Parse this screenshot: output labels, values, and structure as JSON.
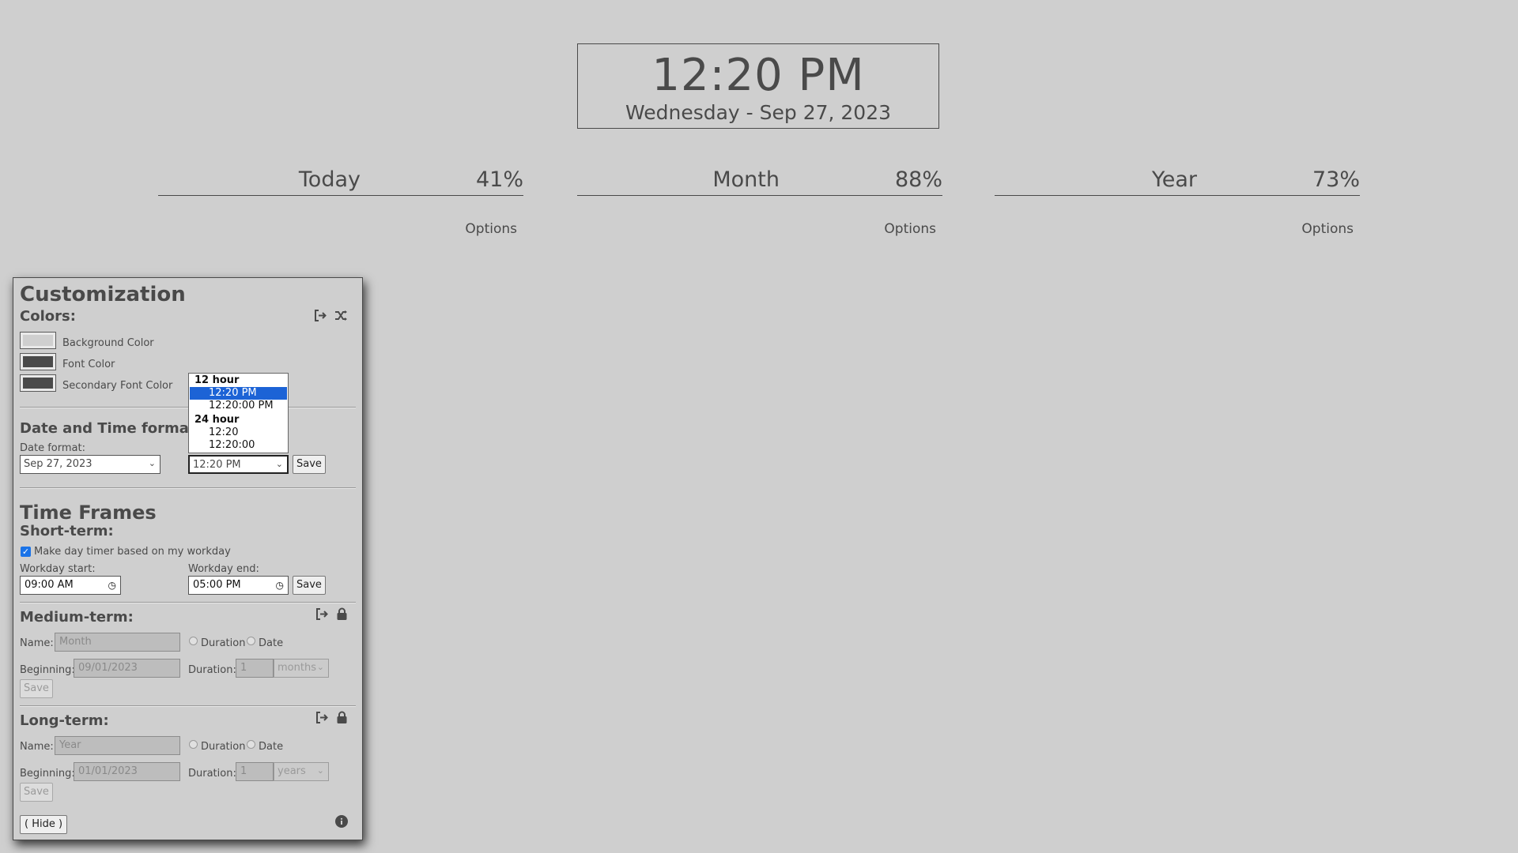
{
  "clock": {
    "time": "12:20 PM",
    "date": "Wednesday - Sep 27, 2023"
  },
  "timers": [
    {
      "name": "Today",
      "percent": "41%",
      "options_label": "Options"
    },
    {
      "name": "Month",
      "percent": "88%",
      "options_label": "Options"
    },
    {
      "name": "Year",
      "percent": "73%",
      "options_label": "Options"
    }
  ],
  "panel": {
    "title": "Customization",
    "colors": {
      "heading": "Colors:",
      "items": [
        {
          "label": "Background Color",
          "value": "#cfcfcf"
        },
        {
          "label": "Font Color",
          "value": "#4a4a4a"
        },
        {
          "label": "Secondary Font Color",
          "value": "#4a4a4a"
        }
      ]
    },
    "datetime": {
      "heading": "Date and Time forma",
      "date_format_label": "Date format:",
      "date_format_value": "Sep 27, 2023",
      "time_format_value": "12:20 PM",
      "save_label": "Save",
      "dropdown": {
        "group_12": "12 hour",
        "opt_1": "12:20 PM",
        "opt_2": "12:20:00 PM",
        "group_24": "24 hour",
        "opt_3": "12:20",
        "opt_4": "12:20:00"
      }
    },
    "timeframes": {
      "heading": "Time Frames",
      "short": {
        "heading": "Short-term:",
        "checkbox_label": "Make day timer based on my workday",
        "start_label": "Workday start:",
        "start_value": "09:00 AM",
        "end_label": "Workday end:",
        "end_value": "05:00 PM",
        "save_label": "Save"
      },
      "medium": {
        "heading": "Medium-term:",
        "name_label": "Name:",
        "name_value": "Month",
        "radio_duration": "Duration",
        "radio_date": "Date",
        "beginning_label": "Beginning:",
        "beginning_value": "09/01/2023",
        "duration_label": "Duration:",
        "duration_value": "1",
        "unit_value": "months",
        "save_label": "Save"
      },
      "long": {
        "heading": "Long-term:",
        "name_label": "Name:",
        "name_value": "Year",
        "radio_duration": "Duration",
        "radio_date": "Date",
        "beginning_label": "Beginning:",
        "beginning_value": "01/01/2023",
        "duration_label": "Duration:",
        "duration_value": "1",
        "unit_value": "years",
        "save_label": "Save"
      }
    },
    "hide_label": "( Hide )",
    "icons": {
      "export": "export-icon",
      "shuffle": "shuffle-icon",
      "lock": "lock-icon",
      "info": "info-icon",
      "clock": "clock-icon"
    }
  }
}
